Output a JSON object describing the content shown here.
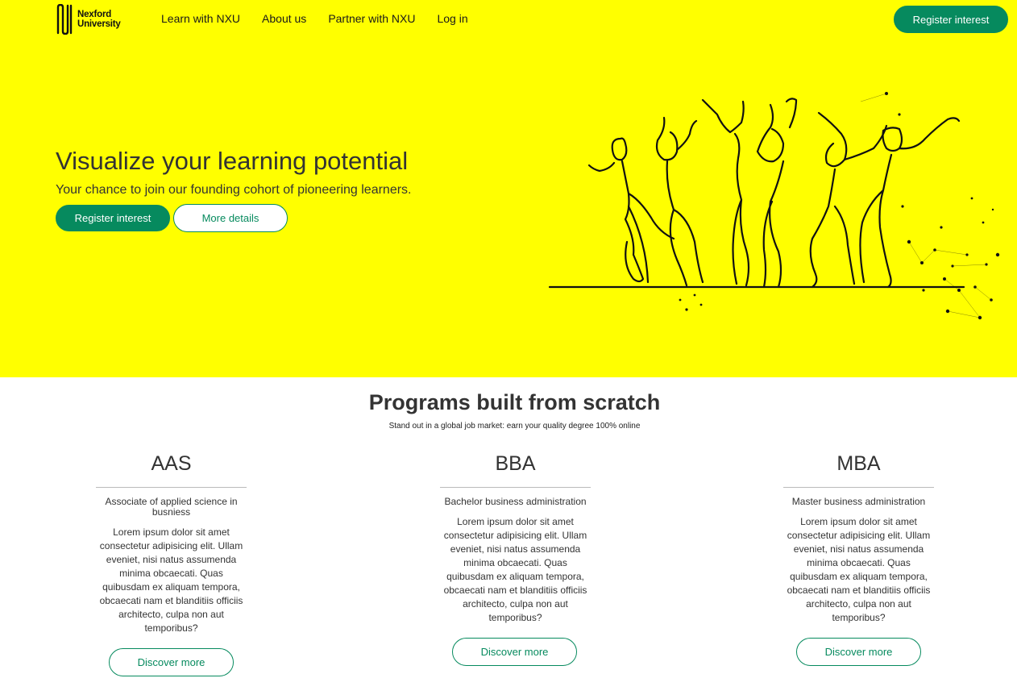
{
  "brand": {
    "logo_line1": "Nexford",
    "logo_line2": "University"
  },
  "nav": {
    "items": [
      {
        "label": "Learn with NXU"
      },
      {
        "label": "About us"
      },
      {
        "label": "Partner with NXU"
      },
      {
        "label": "Log in"
      }
    ],
    "register_label": "Register interest"
  },
  "hero": {
    "title": "Visualize your learning potential",
    "subtitle": "Your chance to join our founding cohort of pioneering learners.",
    "primary_button": "Register interest",
    "secondary_button": "More details",
    "illustration": "celebrating-people-line-art"
  },
  "programs": {
    "title": "Programs built from scratch",
    "subtitle": "Stand out in a global job market: earn your quality degree 100% online",
    "cards": [
      {
        "code": "AAS",
        "name": "Associate of applied science in busniess",
        "description": "Lorem ipsum dolor sit amet consectetur adipisicing elit. Ullam eveniet, nisi natus assumenda minima obcaecati. Quas quibusdam ex aliquam tempora, obcaecati nam et blanditiis officiis architecto, culpa non aut temporibus?",
        "button": "Discover more"
      },
      {
        "code": "BBA",
        "name": "Bachelor business administration",
        "description": "Lorem ipsum dolor sit amet consectetur adipisicing elit. Ullam eveniet, nisi natus assumenda minima obcaecati. Quas quibusdam ex aliquam tempora, obcaecati nam et blanditiis officiis architecto, culpa non aut temporibus?",
        "button": "Discover more"
      },
      {
        "code": "MBA",
        "name": "Master business administration",
        "description": "Lorem ipsum dolor sit amet consectetur adipisicing elit. Ullam eveniet, nisi natus assumenda minima obcaecati. Quas quibusdam ex aliquam tempora, obcaecati nam et blanditiis officiis architecto, culpa non aut temporibus?",
        "button": "Discover more"
      }
    ]
  },
  "colors": {
    "hero_background": "#ffff00",
    "accent_green": "#068a5e",
    "text": "#333333"
  }
}
